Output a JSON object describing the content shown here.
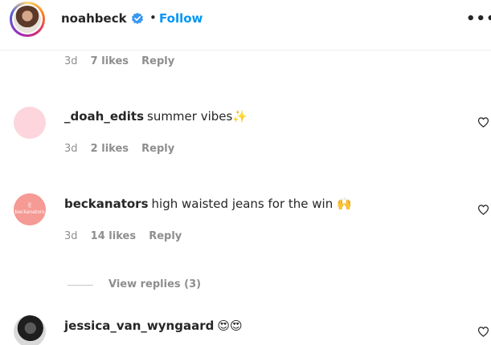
{
  "header": {
    "username": "noahbeck",
    "separator": "•",
    "follow_label": "Follow",
    "more_label": "•••"
  },
  "comments": [
    {
      "username": "",
      "text": "",
      "time": "3d",
      "likes": "7 likes",
      "reply": "Reply"
    },
    {
      "username": "_doah_edits",
      "text": "summer vibes✨",
      "time": "3d",
      "likes": "2 likes",
      "reply": "Reply",
      "avatar_color": "#fdd5dc"
    },
    {
      "username": "beckanators",
      "text": "high waisted jeans for the win 🙌",
      "time": "3d",
      "likes": "14 likes",
      "reply": "Reply",
      "avatar_color": "#f59a94",
      "avatar_text": "beckanators"
    },
    {
      "username": "jessica_van_wyngaard",
      "text": "😍😍",
      "avatar_color": "#1e1e1e"
    }
  ],
  "view_replies_label": "View replies (3)",
  "colors": {
    "accent": "#0095f6",
    "verified": "#3897f0",
    "muted": "#8e8e8e",
    "text": "#262626"
  },
  "icons": {
    "verified": "verified-badge-icon",
    "like": "heart-outline-icon",
    "more": "more-options-icon"
  }
}
